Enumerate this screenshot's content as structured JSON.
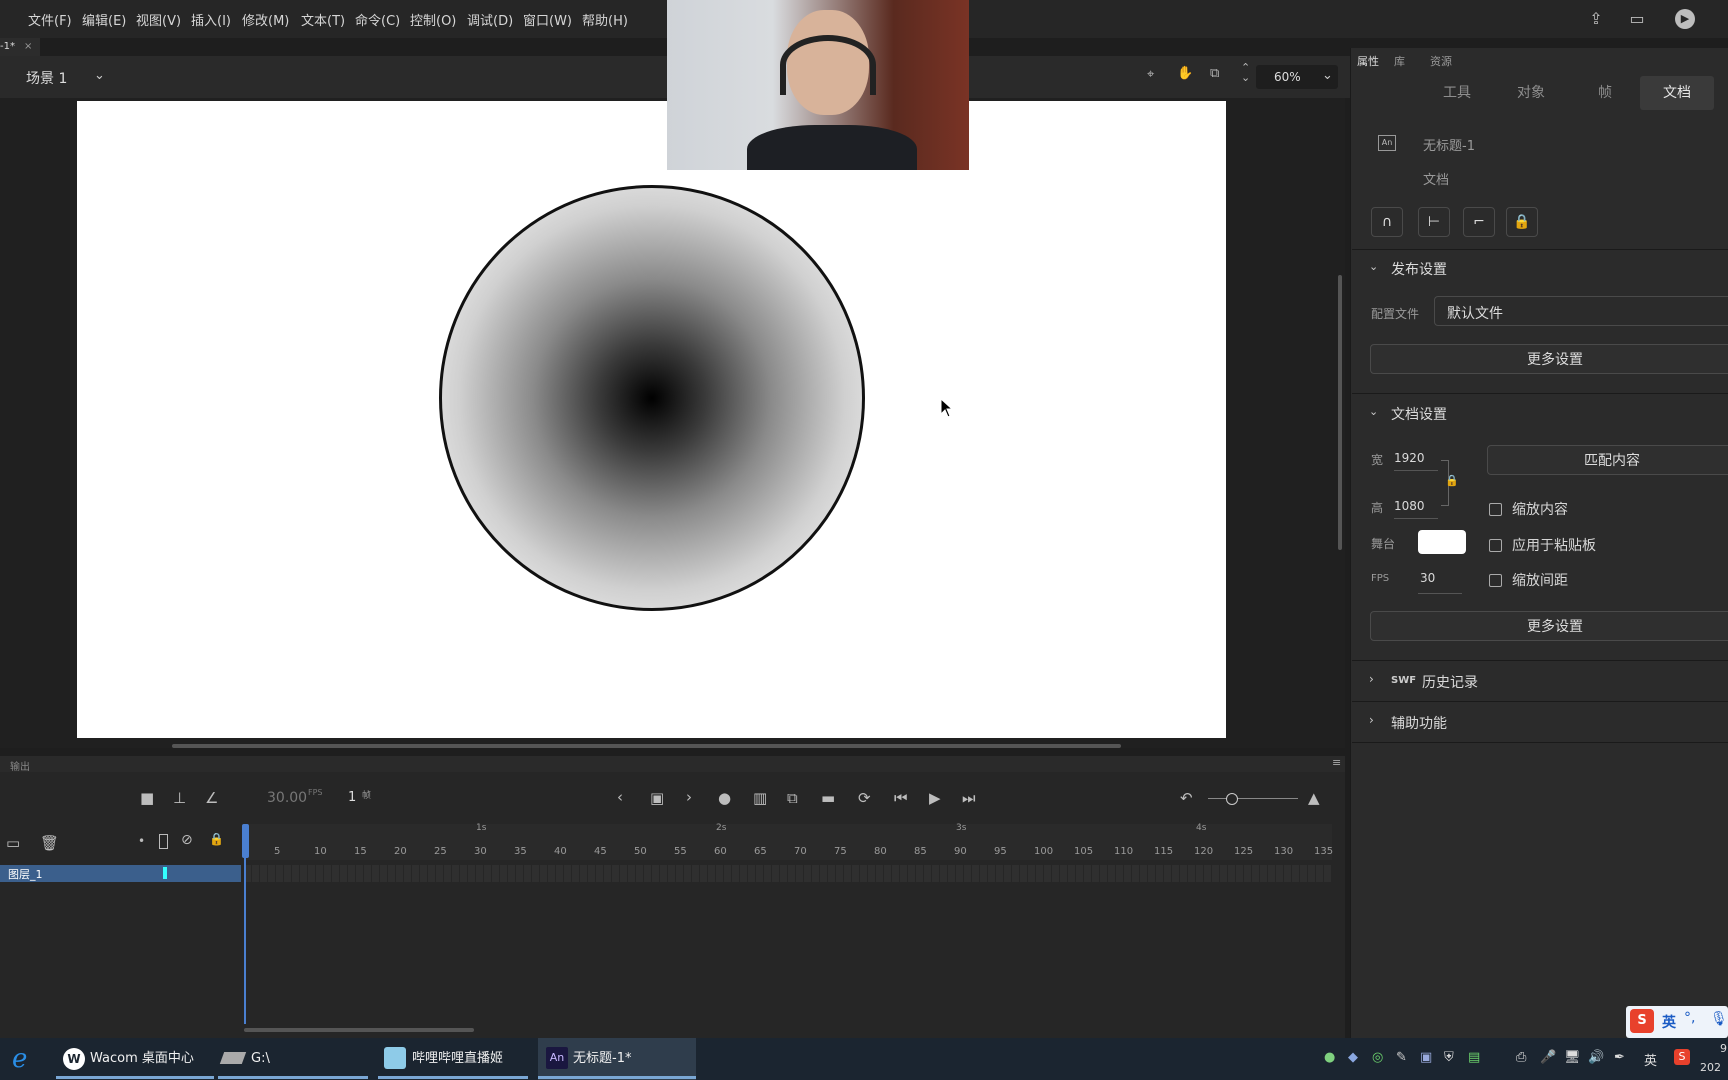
{
  "menubar": {
    "items": [
      "文件(F)",
      "编辑(E)",
      "视图(V)",
      "插入(I)",
      "修改(M)",
      "文本(T)",
      "命令(C)",
      "控制(O)",
      "调试(D)",
      "窗口(W)",
      "帮助(H)"
    ]
  },
  "doc_tab": {
    "label": "-1*"
  },
  "scene": {
    "label": "场景 1",
    "zoom": "60%"
  },
  "right_panel": {
    "top_tabs": [
      "属性",
      "库",
      "资源"
    ],
    "sub_tabs": [
      "工具",
      "对象",
      "帧",
      "文档"
    ],
    "doc_icon": "An",
    "doc_name": "无标题-1",
    "doc_type": "文档",
    "publish_section": "发布设置",
    "profile_label": "配置文件",
    "profile_value": "默认文件",
    "more_settings_1": "更多设置",
    "doc_section": "文档设置",
    "width_label": "宽",
    "width_value": "1920",
    "height_label": "高",
    "height_value": "1080",
    "match_content": "匹配内容",
    "scale_content": "缩放内容",
    "apply_pasteboard": "应用于粘贴板",
    "scale_spacing": "缩放间距",
    "stage_label": "舞台",
    "stage_color": "#ffffff",
    "fps_label": "FPS",
    "fps_value": "30",
    "more_settings_2": "更多设置",
    "swf_prefix": "SWF",
    "swf_history": "历史记录",
    "accessibility": "辅助功能"
  },
  "timeline": {
    "output_label": "输出",
    "fps_display": "30.00",
    "fps_unit": "FPS",
    "frame_display": "1",
    "frame_unit": "帧",
    "layer_name": "图层_1",
    "ruler_seconds": [
      "1s",
      "2s",
      "3s",
      "4s"
    ],
    "ruler_frames": [
      "5",
      "10",
      "15",
      "20",
      "25",
      "30",
      "35",
      "40",
      "45",
      "50",
      "55",
      "60",
      "65",
      "70",
      "75",
      "80",
      "85",
      "90",
      "95",
      "100",
      "105",
      "110",
      "115",
      "120",
      "125",
      "130",
      "135"
    ]
  },
  "taskbar": {
    "items": [
      "Wacom 桌面中心",
      "G:\\",
      "哔哩哔哩直播姬",
      "无标题-1*"
    ],
    "an_badge": "An",
    "ime": "英",
    "clock_partial": "9",
    "clock_year_partial": "202"
  }
}
